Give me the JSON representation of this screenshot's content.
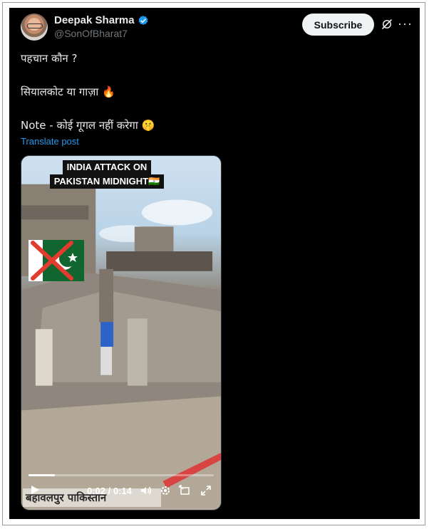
{
  "post": {
    "author_name": "Deepak Sharma",
    "author_handle": "@SonOfBharat7",
    "subscribe_label": "Subscribe",
    "more_label": "···",
    "lines": [
      "पहचान कौन ?",
      "सियालकोट  या  गाज़ा 🔥",
      "Note - कोई गूगल नहीं करेगा 🤫"
    ],
    "translate_label": "Translate post"
  },
  "video": {
    "caption_line1": "INDIA ATTACK ON",
    "caption_line2": "PAKISTAN MIDNIGHT🇮🇳",
    "bottom_banner": "बहावलपुर पाकिस्तान",
    "time": "0:02 / 0:14",
    "progress": 0.143
  },
  "colors": {
    "background": "#000000",
    "text": "#e7e9ea",
    "muted": "#71767b",
    "link": "#1d9bf0",
    "verified": "#1d9bf0"
  }
}
